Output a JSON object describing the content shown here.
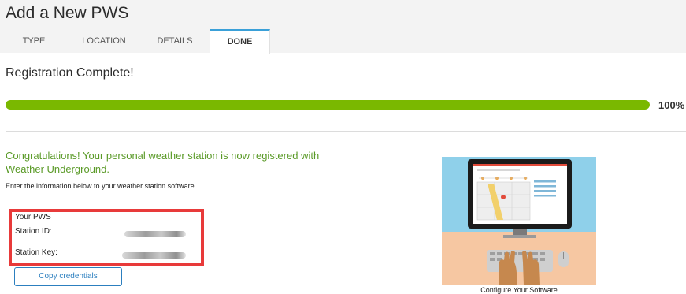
{
  "page": {
    "title": "Add a New PWS",
    "subtitle": "Registration Complete!"
  },
  "tabs": [
    {
      "label": "TYPE",
      "active": false
    },
    {
      "label": "LOCATION",
      "active": false
    },
    {
      "label": "DETAILS",
      "active": false
    },
    {
      "label": "DONE",
      "active": true
    }
  ],
  "progress": {
    "percent": 100,
    "label": "100%",
    "color": "#7ab800"
  },
  "message": {
    "congrats": "Congratulations! Your personal weather station is now registered with Weather Underground.",
    "instructions": "Enter the information below to your weather station software."
  },
  "credentials": {
    "title": "Your PWS",
    "station_id_label": "Station ID:",
    "station_key_label": "Station Key:",
    "highlight_color": "#e83a3a"
  },
  "copy_button": {
    "label": "Copy credentials"
  },
  "illustration": {
    "caption": "Configure Your Software"
  },
  "colors": {
    "accent": "#3aa0d8",
    "link": "#2c7fbf",
    "success_text": "#5a9a27"
  }
}
